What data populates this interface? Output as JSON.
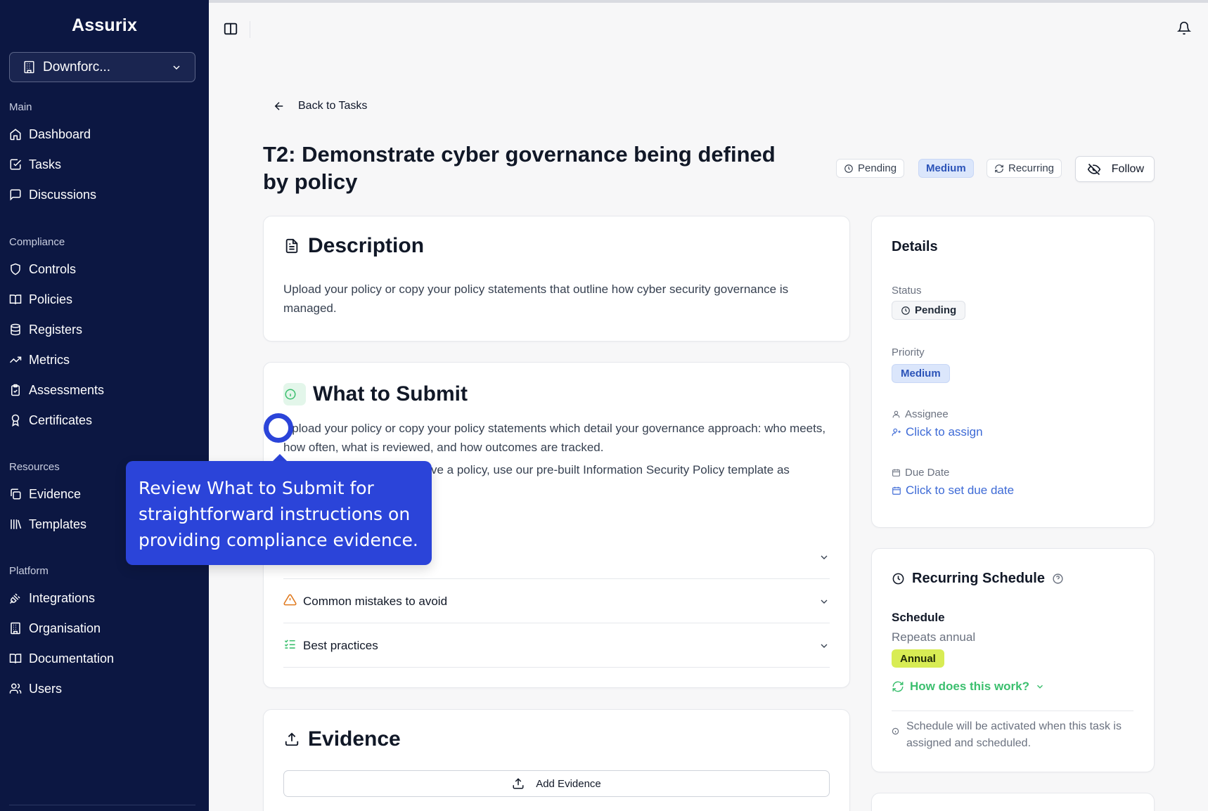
{
  "app": {
    "brand": "Assurix"
  },
  "org_select": {
    "label": "Downforc..."
  },
  "sidebar": {
    "sections": [
      {
        "title": "Main",
        "items": [
          {
            "label": "Dashboard",
            "icon": "home-icon"
          },
          {
            "label": "Tasks",
            "icon": "check-square-icon"
          },
          {
            "label": "Discussions",
            "icon": "message-icon"
          }
        ]
      },
      {
        "title": "Compliance",
        "items": [
          {
            "label": "Controls",
            "icon": "shield-icon"
          },
          {
            "label": "Policies",
            "icon": "book-icon"
          },
          {
            "label": "Registers",
            "icon": "database-icon"
          },
          {
            "label": "Metrics",
            "icon": "trending-up-icon"
          },
          {
            "label": "Assessments",
            "icon": "clipboard-check-icon"
          },
          {
            "label": "Certificates",
            "icon": "award-icon"
          }
        ]
      },
      {
        "title": "Resources",
        "items": [
          {
            "label": "Evidence",
            "icon": "copy-icon"
          },
          {
            "label": "Templates",
            "icon": "library-icon"
          }
        ]
      },
      {
        "title": "Platform",
        "items": [
          {
            "label": "Integrations",
            "icon": "plug-icon"
          },
          {
            "label": "Organisation",
            "icon": "building-icon"
          },
          {
            "label": "Documentation",
            "icon": "book-open-icon"
          },
          {
            "label": "Users",
            "icon": "users-icon"
          }
        ]
      }
    ]
  },
  "back_link": "Back to Tasks",
  "task": {
    "title": "T2: Demonstrate cyber governance being defined by policy",
    "badges": {
      "status": "Pending",
      "priority": "Medium",
      "recurring": "Recurring"
    },
    "follow_label": "Follow"
  },
  "description": {
    "title": "Description",
    "text": "Upload your policy or copy your policy statements that outline how cyber security governance is managed."
  },
  "what_to_submit": {
    "title": "What to Submit",
    "text1": "Upload your policy or copy your policy statements which detail your governance approach: who meets, how often, what is reviewed, and how outcomes are tracked.",
    "text2": "ve a policy, use our pre-built Information Security Policy template as",
    "accordions": [
      {
        "label": "",
        "icon": ""
      },
      {
        "label": "Common mistakes to avoid",
        "icon": "warning-icon"
      },
      {
        "label": "Best practices",
        "icon": "list-checks-icon"
      }
    ]
  },
  "evidence": {
    "title": "Evidence",
    "add_label": "Add Evidence"
  },
  "details": {
    "title": "Details",
    "status_label": "Status",
    "status_value": "Pending",
    "priority_label": "Priority",
    "priority_value": "Medium",
    "assignee_label": "Assignee",
    "assignee_action": "Click to assign",
    "due_label": "Due Date",
    "due_action": "Click to set due date"
  },
  "recurring": {
    "title": "Recurring Schedule",
    "schedule_label": "Schedule",
    "schedule_desc": "Repeats annual",
    "frequency": "Annual",
    "how_link": "How does this work?",
    "note": "Schedule will be activated when this task is assigned and scheduled."
  },
  "tooltip": {
    "text": "Review What to Submit for straightforward instructions on providing compliance evidence."
  },
  "colors": {
    "sidebar_bg": "#0c1742",
    "accent_blue": "#2b44d9",
    "link_blue": "#3d6ad6",
    "green": "#3bbf6e",
    "annual": "#d8ec54"
  }
}
